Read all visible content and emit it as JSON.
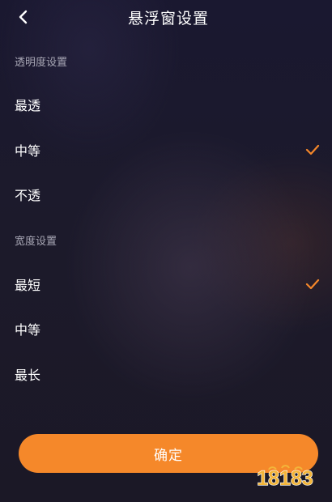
{
  "header": {
    "title": "悬浮窗设置",
    "back_icon": "chevron-left-icon"
  },
  "sections": [
    {
      "label": "透明度设置",
      "options": [
        {
          "label": "最透",
          "selected": false
        },
        {
          "label": "中等",
          "selected": true
        },
        {
          "label": "不透",
          "selected": false
        }
      ]
    },
    {
      "label": "宽度设置",
      "options": [
        {
          "label": "最短",
          "selected": true
        },
        {
          "label": "中等",
          "selected": false
        },
        {
          "label": "最长",
          "selected": false
        }
      ]
    }
  ],
  "confirm_label": "确定",
  "watermark_text": "18183",
  "colors": {
    "accent": "#f5882a",
    "background": "#1c1a2b",
    "check": "#f5882a",
    "section_label": "#a7a6b4"
  }
}
